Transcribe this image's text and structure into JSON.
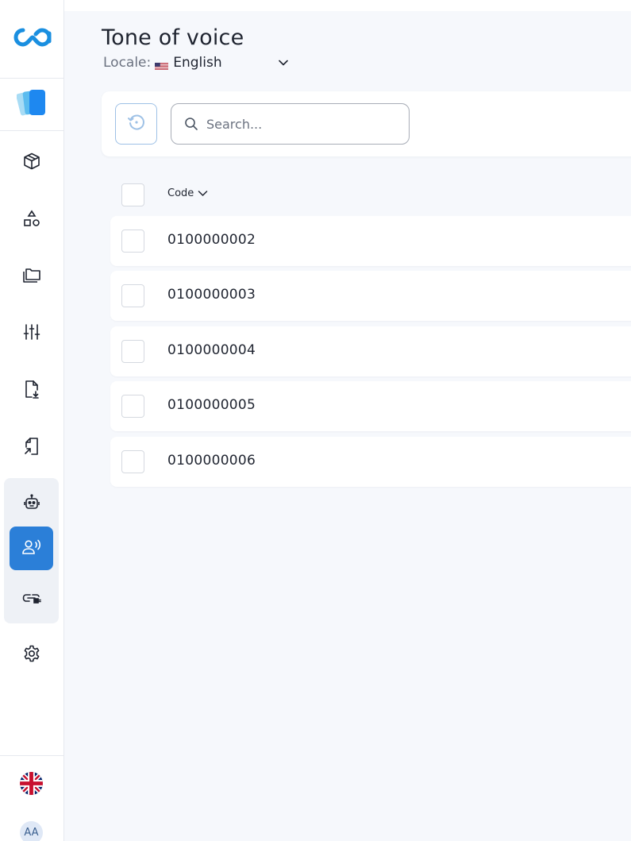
{
  "page": {
    "title": "Tone of voice",
    "locale_label": "Locale:",
    "locale_value": "English"
  },
  "toolbar": {
    "search_placeholder": "Search..."
  },
  "table": {
    "columns": [
      "Code"
    ],
    "rows": [
      {
        "code": "0100000002"
      },
      {
        "code": "0100000003"
      },
      {
        "code": "0100000004"
      },
      {
        "code": "0100000005"
      },
      {
        "code": "0100000006"
      }
    ]
  },
  "user": {
    "initials": "AA"
  },
  "colors": {
    "accent": "#2b7fd8",
    "background": "#f6f8fc",
    "logo": "#1a8fe0"
  },
  "icons": {
    "nav": [
      "box-icon",
      "shapes-icon",
      "folders-icon",
      "sliders-icon",
      "file-download-icon",
      "file-import-icon",
      "robot-icon",
      "voice-icon",
      "link-plug-icon",
      "gear-icon"
    ],
    "active": "voice-icon"
  }
}
